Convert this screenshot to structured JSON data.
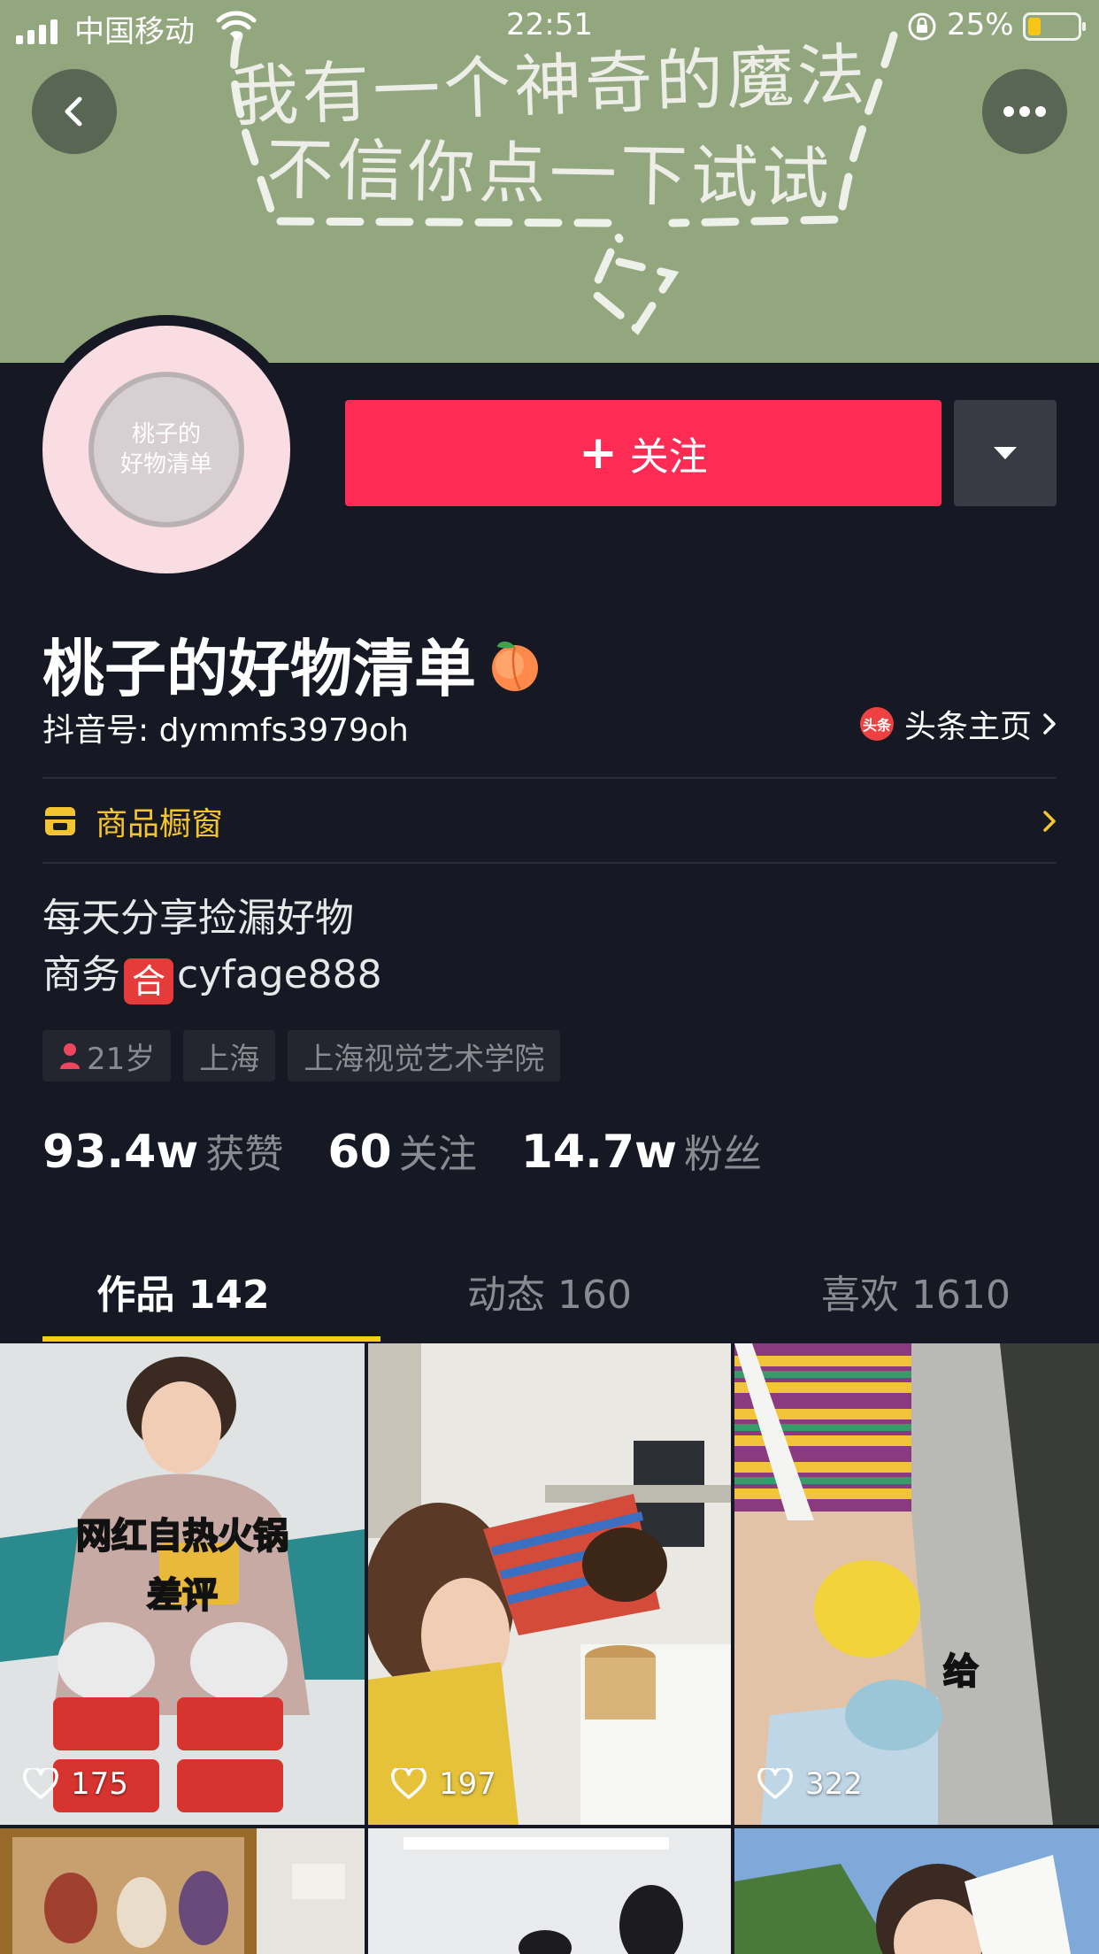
{
  "status_bar": {
    "carrier": "中国移动",
    "time": "22:51",
    "battery_percent_label": "25%",
    "battery_level": 0.25
  },
  "banner": {
    "line1": "我有一个神奇的魔法",
    "line2": "不信你点一下试试"
  },
  "header": {
    "back_icon": "chevron-left-icon",
    "more_icon": "more-horizontal-icon"
  },
  "avatar": {
    "line1": "桃子的",
    "line2": "好物清单"
  },
  "actions": {
    "follow_label": "关注",
    "follow_color": "#fe2c55"
  },
  "profile": {
    "nickname": "桃子的好物清单",
    "douyin_id": "抖音号: dymmfs3979oh",
    "toutiao_badge": "头条",
    "toutiao_label": "头条主页",
    "shop_label": "商品橱窗",
    "bio_line1": "每天分享捡漏好物",
    "bio_line2_prefix": "商务",
    "bio_badge": "合",
    "bio_line2_suffix": "cyfage888",
    "tags": [
      "21岁",
      "上海",
      "上海视觉艺术学院"
    ]
  },
  "stats": [
    {
      "value": "93.4w",
      "label": "获赞"
    },
    {
      "value": "60",
      "label": "关注"
    },
    {
      "value": "14.7w",
      "label": "粉丝"
    }
  ],
  "tabs": [
    {
      "label": "作品 142",
      "active": true
    },
    {
      "label": "动态 160",
      "active": false
    },
    {
      "label": "喜欢 1610",
      "active": false
    }
  ],
  "videos": [
    {
      "likes": "175",
      "caption1": "网红自热火锅",
      "caption2": "差评"
    },
    {
      "likes": "197"
    },
    {
      "likes": "322",
      "caption1": "给"
    }
  ],
  "colors": {
    "background": "#161823",
    "accent": "#fe2c55",
    "tab_indicator": "#face15",
    "shop": "#f5c530"
  }
}
